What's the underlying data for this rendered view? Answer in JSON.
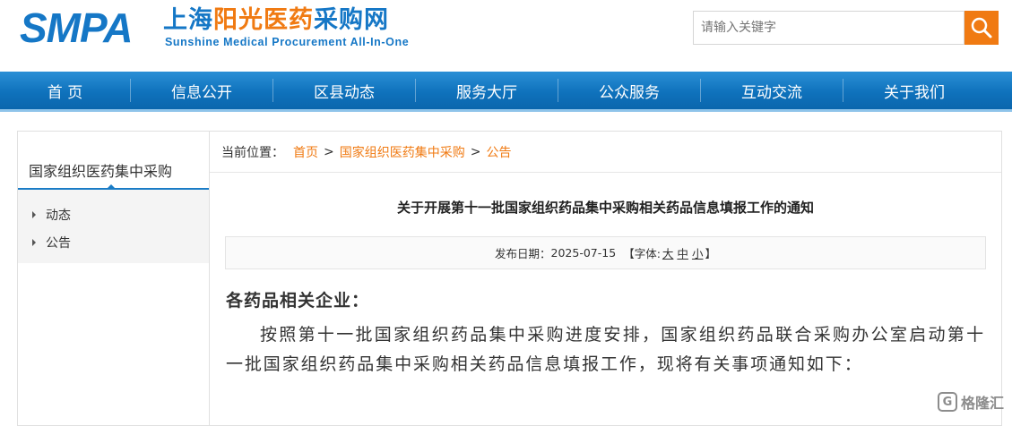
{
  "header": {
    "logo_main": "SMPA",
    "logo_cn_part1": "上海",
    "logo_cn_highlight": "阳光医药",
    "logo_cn_part2": "采购网",
    "logo_en": "Sunshine Medical Procurement All-In-One",
    "search_placeholder": "请输入关键字"
  },
  "nav": {
    "items": [
      "首 页",
      "信息公开",
      "区县动态",
      "服务大厅",
      "公众服务",
      "互动交流",
      "关于我们"
    ]
  },
  "sidebar": {
    "title": "国家组织医药集中采购",
    "items": [
      "动态",
      "公告"
    ]
  },
  "breadcrumb": {
    "label": "当前位置：",
    "links": [
      "首页",
      "国家组织医药集中采购",
      "公告"
    ],
    "separator": ">"
  },
  "article": {
    "title": "关于开展第十一批国家组织药品集中采购相关药品信息填报工作的通知",
    "meta_date_label": "发布日期：",
    "meta_date": "2025-07-15",
    "font_label": "【字体:",
    "font_large": "大",
    "font_medium": "中",
    "font_small": "小",
    "font_close": "】",
    "salutation": "各药品相关企业：",
    "paragraph": "按照第十一批国家组织药品集中采购进度安排，国家组织药品联合采购办公室启动第十一批国家组织药品集中采购相关药品信息填报工作，现将有关事项通知如下："
  },
  "watermark": {
    "text": "格隆汇"
  },
  "colors": {
    "brand_blue": "#1577c6",
    "accent_orange": "#f07a12"
  }
}
